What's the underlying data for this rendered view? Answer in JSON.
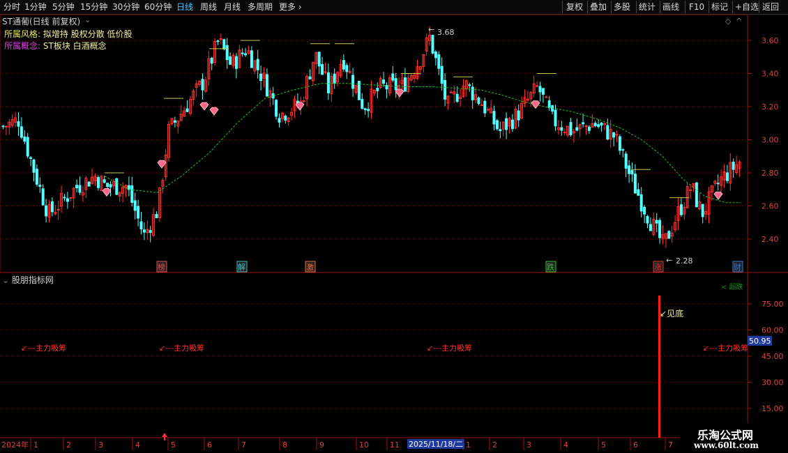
{
  "toolbar": {
    "periods": [
      "分时",
      "1分钟",
      "5分钟",
      "15分钟",
      "30分钟",
      "60分钟",
      "日线",
      "周线",
      "月线",
      "多周期",
      "更多"
    ],
    "active_period": "日线",
    "right_buttons": [
      "复权",
      "叠加",
      "多股",
      "统计",
      "画线",
      "F10",
      "标记",
      "+自选",
      "返回"
    ]
  },
  "main_chart": {
    "title": "ST通葡(日线 前复权)",
    "style_label": "所属风格:",
    "style_value": "拟增持 股权分散 低价股",
    "concept_label": "所属概念:",
    "concept_value": "ST板块 白酒概念",
    "price_ticks": [
      "3.60",
      "3.40",
      "3.20",
      "3.00",
      "2.80",
      "2.60",
      "2.40"
    ],
    "high_label": "3.68",
    "low_label": "2.28",
    "event_markers": [
      "榜",
      "解",
      "激",
      "跌",
      "涨",
      "财"
    ]
  },
  "sub_chart": {
    "title": "股朋指标网",
    "ticks": [
      "75.00",
      "60.00",
      "45.00",
      "30.00",
      "15.00"
    ],
    "current_value": "50.95",
    "signal_bottom": "见底",
    "signal_accumulate": "主力吸筹",
    "faint_label": "< 超跌"
  },
  "date_axis": {
    "year": "2024年",
    "months": [
      "1",
      "2",
      "3",
      "4",
      "5",
      "6",
      "7",
      "8",
      "9",
      "10",
      "11",
      "1",
      "2",
      "3",
      "4",
      "5",
      "6",
      "7"
    ],
    "cursor_date": "2025/11/18/二"
  },
  "watermark": {
    "name": "乐淘公式网",
    "url": "www.60lt.com"
  },
  "colors": {
    "up": "#ff3030",
    "down": "#54ffff",
    "ma": "#20c020",
    "grid": "#7a1010",
    "signal_text": "#ff3030",
    "bottom_text": "#f0f0a0",
    "active_period": "#39c7ff"
  }
}
